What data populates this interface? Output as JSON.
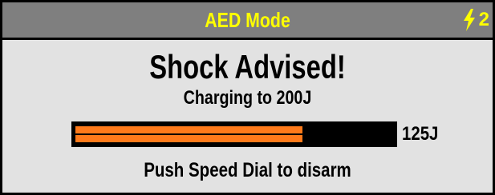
{
  "header": {
    "title": "AED Mode",
    "shock_count": "2",
    "shock_icon": "lightning-bolt-icon"
  },
  "main": {
    "headline": "Shock Advised!",
    "charging_text": "Charging to 200J",
    "charge_value": "125J",
    "charge_progress": 0.715,
    "hint": "Push Speed Dial to disarm"
  },
  "colors": {
    "title_bar": "#7f7f7f",
    "title_text": "#ffff00",
    "content_bg": "#e2e2e2",
    "charge_fill": "#ff7a1a",
    "charge_track": "#000000"
  }
}
